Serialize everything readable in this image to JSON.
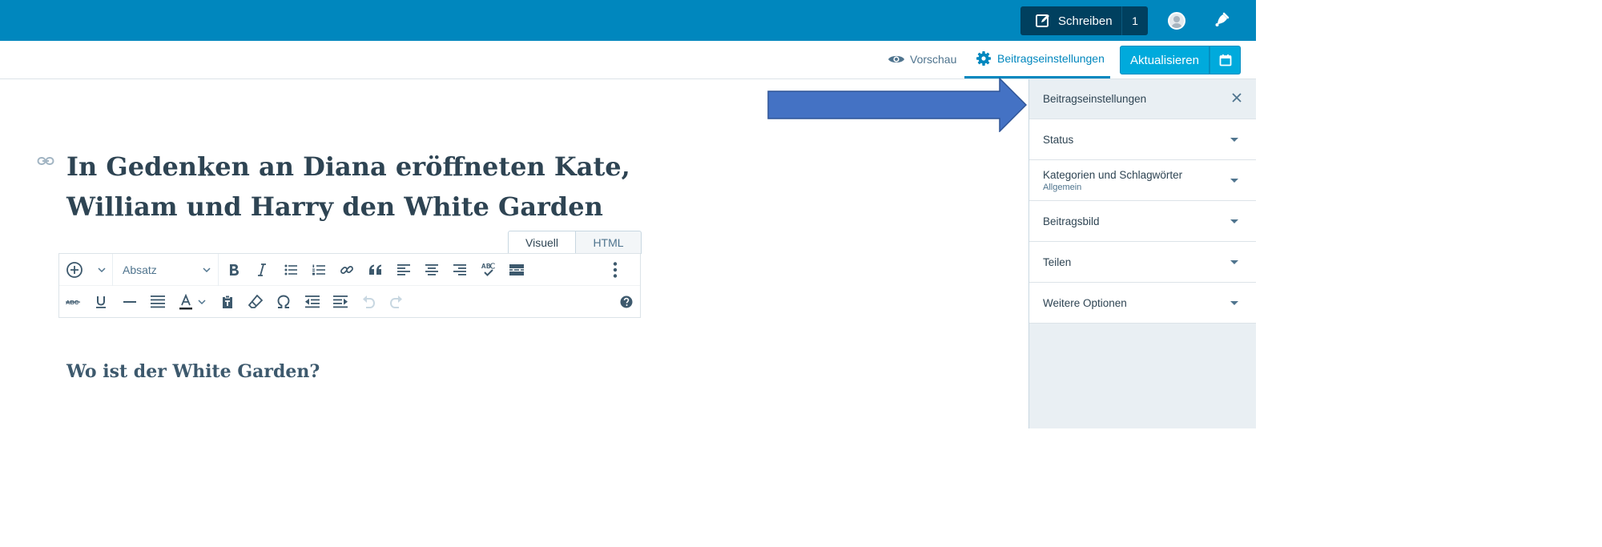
{
  "topbar": {
    "write_label": "Schreiben",
    "drafts_count": "1"
  },
  "editor_header": {
    "preview_label": "Vorschau",
    "settings_tab_label": "Beitragseinstellungen",
    "update_label": "Aktualisieren"
  },
  "post": {
    "title": "In Gedenken an Diana eröffneten Kate, William und Harry den White Garden",
    "subheading": "Wo ist der White Garden?"
  },
  "editor": {
    "tabs": [
      "Visuell",
      "HTML"
    ],
    "format_select_value": "Absatz"
  },
  "sidebar": {
    "title": "Beitragseinstellungen",
    "sections": [
      {
        "label": "Status"
      },
      {
        "label": "Kategorien und Schlagwörter",
        "sub": "Allgemein"
      },
      {
        "label": "Beitragsbild"
      },
      {
        "label": "Teilen"
      },
      {
        "label": "Weitere Optionen"
      }
    ]
  },
  "colors": {
    "topbar": "#0087be",
    "write_button": "#00405f",
    "primary_button": "#00aadc",
    "accent": "#0087be",
    "annotation_arrow": "#4472c4",
    "sidebar_bg": "#e9eff3"
  },
  "icons": [
    "write-icon",
    "avatar-icon",
    "notification-bell-icon",
    "eye-icon",
    "gear-icon",
    "calendar-icon",
    "close-icon",
    "link-icon",
    "add-block-icon",
    "bold-icon",
    "italic-icon",
    "bullet-list-icon",
    "numbered-list-icon",
    "insert-link-icon",
    "blockquote-icon",
    "align-left-icon",
    "align-center-icon",
    "align-right-icon",
    "spellcheck-icon",
    "read-more-icon",
    "more-options-icon",
    "strikethrough-icon",
    "underline-icon",
    "horizontal-rule-icon",
    "justify-icon",
    "text-color-icon",
    "paste-text-icon",
    "clear-formatting-icon",
    "special-character-icon",
    "outdent-icon",
    "indent-icon",
    "undo-icon",
    "redo-icon",
    "help-icon"
  ]
}
